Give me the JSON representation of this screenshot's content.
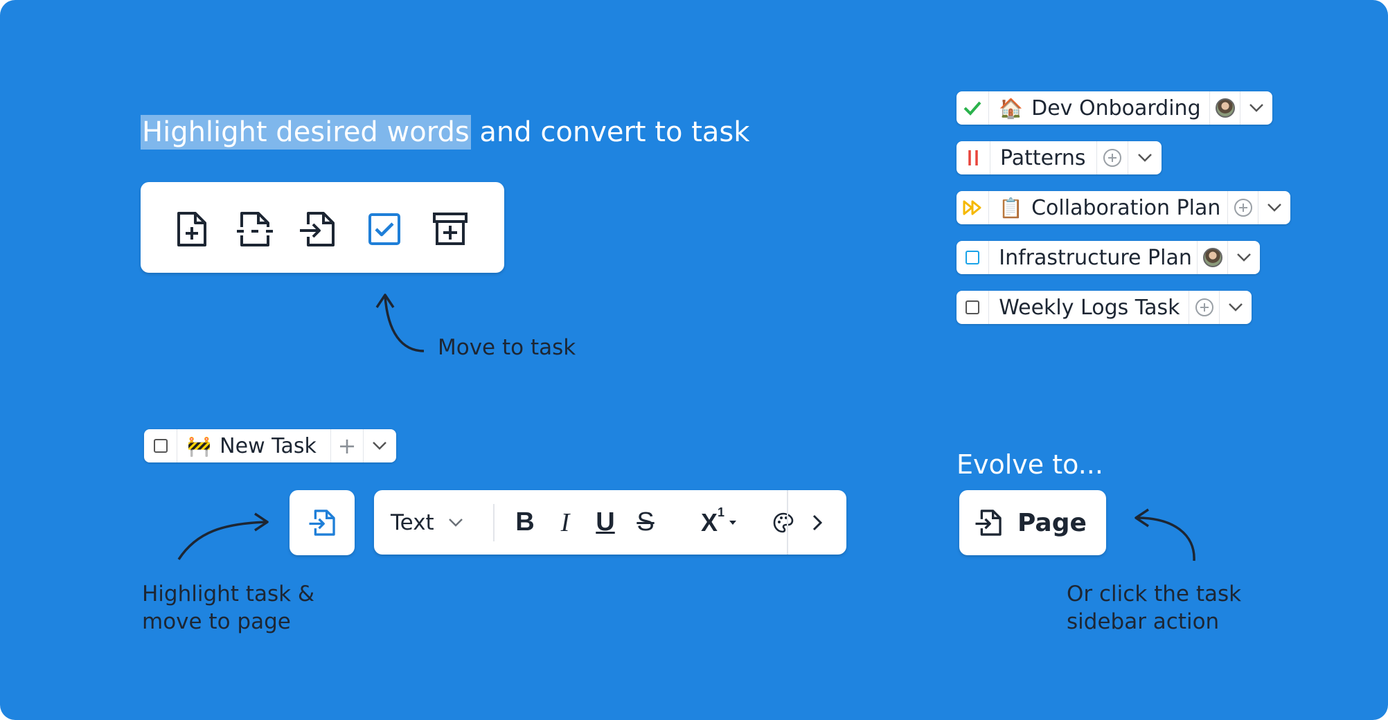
{
  "headline": {
    "highlighted": "Highlight desired words",
    "rest": " and convert to task"
  },
  "notes": {
    "move_to_task": "Move to task",
    "highlight_task_line1": "Highlight task &",
    "highlight_task_line2": "move to page",
    "evolve": "Evolve to...",
    "sidebar_line1": "Or click the task",
    "sidebar_line2": "sidebar action"
  },
  "iconbar": {
    "icons": [
      "new-page-icon",
      "dashed-page-icon",
      "move-to-page-icon",
      "task-checkbox-icon",
      "archive-plus-icon"
    ]
  },
  "tasks": [
    {
      "status": "done",
      "status_icon": "check-icon",
      "emoji": "🏠",
      "label": "Dev Onboarding",
      "action": "avatar"
    },
    {
      "status": "paused",
      "status_icon": "pause-icon",
      "emoji": "",
      "label": "Patterns",
      "action": "add-assignee"
    },
    {
      "status": "in-progress",
      "status_icon": "fast-forward-icon",
      "emoji": "📋",
      "label": "Collaboration Plan",
      "action": "add-assignee"
    },
    {
      "status": "todo",
      "status_icon": "square-blue-icon",
      "emoji": "",
      "label": "Infrastructure Plan",
      "action": "avatar"
    },
    {
      "status": "empty",
      "status_icon": "square-icon",
      "emoji": "",
      "label": "Weekly Logs Task",
      "action": "add-assignee"
    }
  ],
  "new_task": {
    "emoji": "🚧",
    "label": "New Task",
    "plus": "+"
  },
  "toolbar": {
    "text_style": "Text",
    "items": [
      "bold-icon",
      "italic-icon",
      "underline-icon",
      "strikethrough-icon",
      "superscript-icon",
      "palette-icon",
      "chevron-right-icon"
    ],
    "bold": "B",
    "italic": "I",
    "underline": "U",
    "strike": "S",
    "superscript": "X",
    "superscript_num": "1"
  },
  "page_button": {
    "label": "Page"
  },
  "colors": {
    "background": "#1f84e0",
    "highlight": "#7fb7ec",
    "check": "#2bb24c",
    "pause": "#e8453c",
    "progress": "#f5b800",
    "todo": "#1aa3e8",
    "accent": "#1f84e0"
  }
}
